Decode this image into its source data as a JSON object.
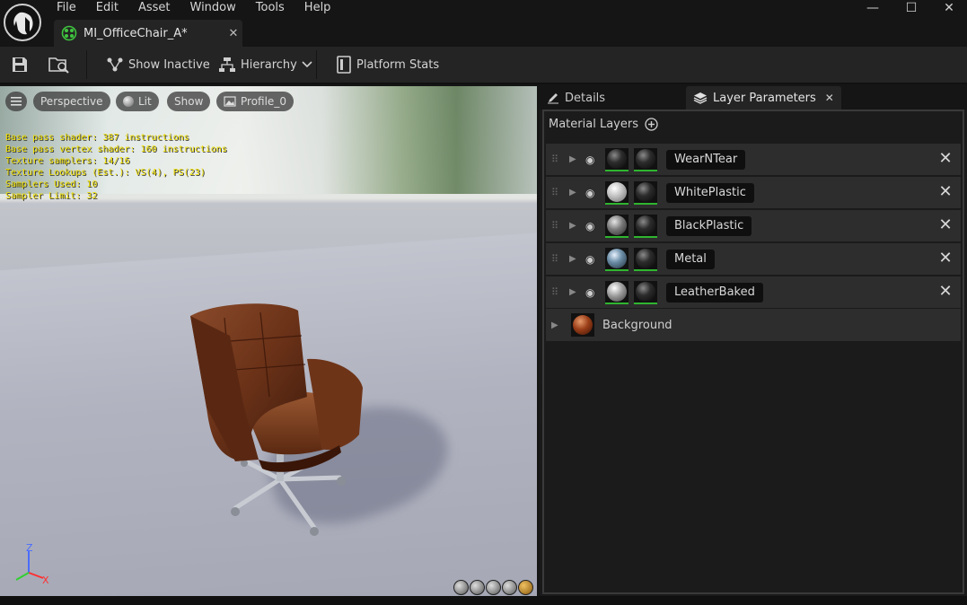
{
  "menu": [
    "File",
    "Edit",
    "Asset",
    "Window",
    "Tools",
    "Help"
  ],
  "window_controls": {
    "minimize": "—",
    "maximize": "☐",
    "close": "✕"
  },
  "asset_tab": {
    "label": "MI_OfficeChair_A*",
    "close": "✕"
  },
  "toolbar": {
    "show_inactive": "Show Inactive",
    "hierarchy": "Hierarchy",
    "platform_stats": "Platform Stats"
  },
  "viewport": {
    "perspective": "Perspective",
    "lit": "Lit",
    "show": "Show",
    "profile": "Profile_0",
    "stats": [
      "Base pass shader: 387 instructions",
      "Base pass vertex shader: 160 instructions",
      "Texture samplers: 14/16",
      "Texture Lookups (Est.): VS(4), PS(23)",
      "Samplers Used: 10",
      "Sampler Limit: 32"
    ],
    "axis": {
      "z": "Z",
      "x": "X"
    }
  },
  "panel": {
    "tab_details": "Details",
    "tab_layer_parameters": "Layer Parameters",
    "tab_close": "✕",
    "section_title": "Material Layers",
    "layers": [
      {
        "name": "WearNTear",
        "sphere": "dark"
      },
      {
        "name": "WhitePlastic",
        "sphere": "white"
      },
      {
        "name": "BlackPlastic",
        "sphere": "grey"
      },
      {
        "name": "Metal",
        "sphere": "metal"
      },
      {
        "name": "LeatherBaked",
        "sphere": "light"
      }
    ],
    "remove_glyph": "✕",
    "background_label": "Background"
  }
}
